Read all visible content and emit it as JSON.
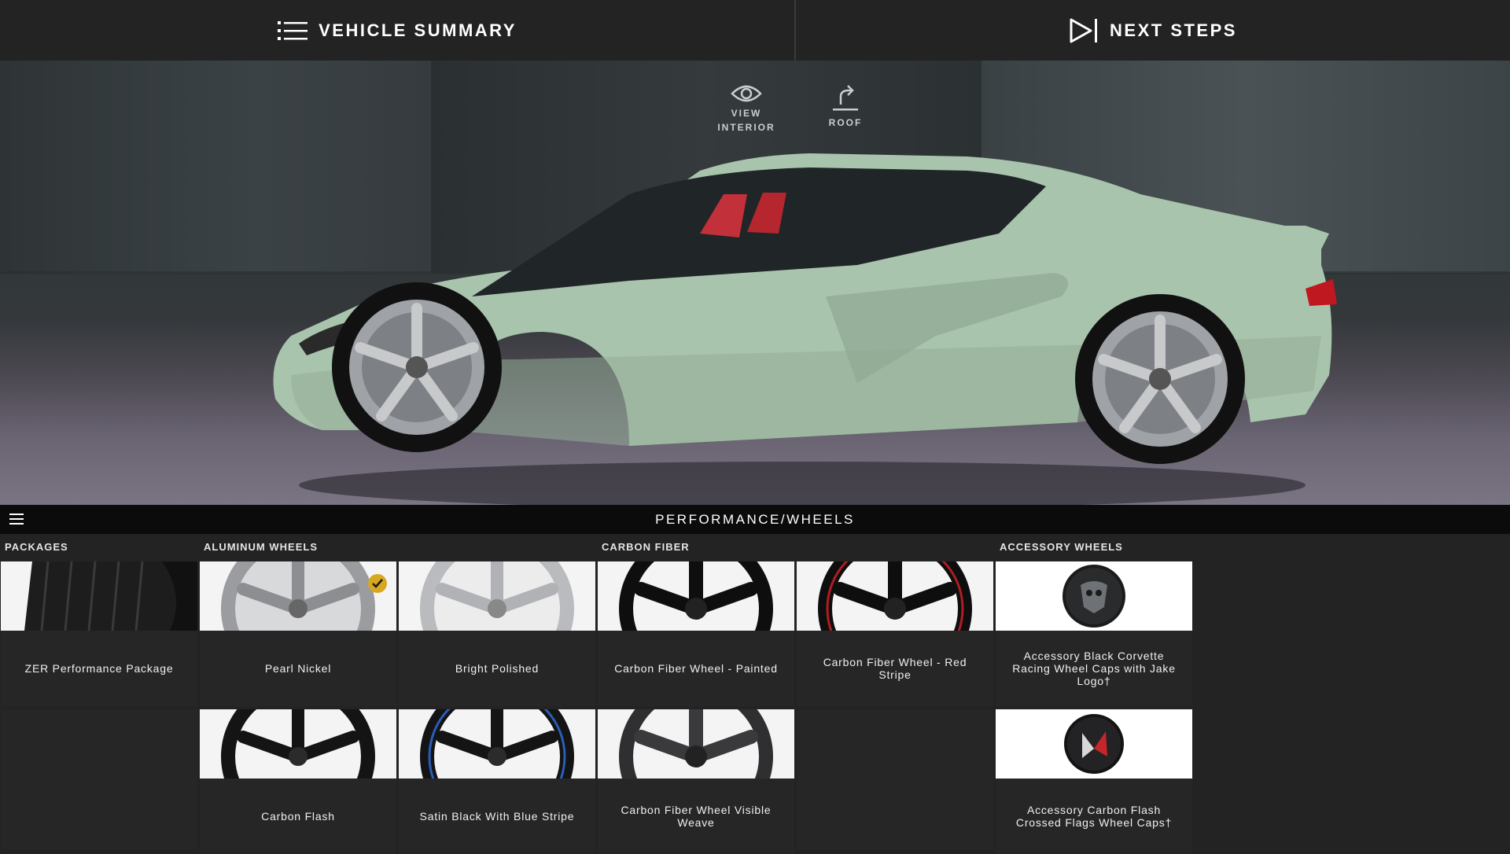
{
  "header": {
    "vehicle_summary_label": "VEHICLE SUMMARY",
    "next_steps_label": "NEXT STEPS",
    "vehicle_summary_icon": "list-icon",
    "next_steps_icon": "play-icon"
  },
  "hero": {
    "view_interior_line1": "VIEW",
    "view_interior_line2": "INTERIOR",
    "roof_label": "ROOF",
    "view_interior_icon": "eye-icon",
    "roof_icon": "roof-toggle-icon",
    "car_color": "#a9c4ad"
  },
  "section": {
    "title": "PERFORMANCE/WHEELS",
    "menu_icon": "hamburger-icon"
  },
  "categories": {
    "packages": "PACKAGES",
    "aluminum_wheels": "ALUMINUM WHEELS",
    "carbon_fiber": "CARBON FIBER",
    "accessory_wheels": "ACCESSORY WHEELS"
  },
  "options": {
    "zer_package": "ZER Performance Package",
    "pearl_nickel": "Pearl Nickel",
    "bright_polished": "Bright Polished",
    "cf_painted": "Carbon Fiber Wheel - Painted",
    "cf_red_stripe": "Carbon Fiber Wheel - Red Stripe",
    "acc_black_caps": "Accessory Black Corvette Racing Wheel Caps with Jake Logo†",
    "carbon_flash": "Carbon Flash",
    "satin_black_blue": "Satin Black With Blue Stripe",
    "cf_visible_weave": "Carbon Fiber Wheel Visible Weave",
    "acc_flags_caps": "Accessory Carbon Flash Crossed Flags Wheel Caps†"
  },
  "selected_option": "Pearl Nickel",
  "colors": {
    "selected_check": "#d7a71e",
    "background": "#232323"
  }
}
